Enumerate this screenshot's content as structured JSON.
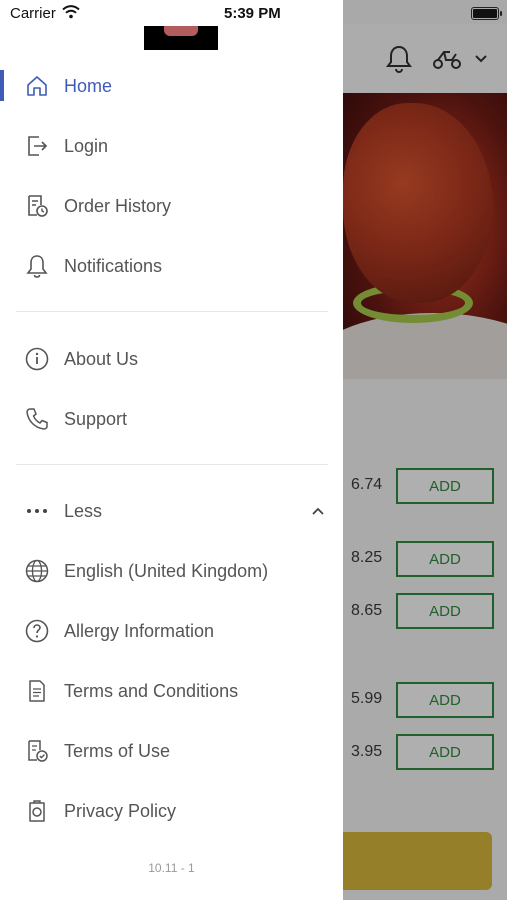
{
  "status_bar": {
    "carrier": "Carrier",
    "time": "5:39 PM"
  },
  "background": {
    "prices": [
      "6.74",
      "8.25",
      "8.65",
      "5.99",
      "3.95"
    ],
    "add_label": "ADD"
  },
  "menu": {
    "items": [
      {
        "label": "Home",
        "icon": "home-icon",
        "active": true
      },
      {
        "label": "Login",
        "icon": "login-icon"
      },
      {
        "label": "Order History",
        "icon": "order-history-icon"
      },
      {
        "label": "Notifications",
        "icon": "bell-icon"
      },
      {
        "label": "About Us",
        "icon": "info-icon"
      },
      {
        "label": "Support",
        "icon": "phone-icon"
      },
      {
        "label": "Less",
        "icon": "more-dots-icon"
      },
      {
        "label": "English (United Kingdom)",
        "icon": "globe-icon"
      },
      {
        "label": "Allergy Information",
        "icon": "help-circle-icon"
      },
      {
        "label": "Terms and Conditions",
        "icon": "document-icon"
      },
      {
        "label": "Terms of Use",
        "icon": "document-check-icon"
      },
      {
        "label": "Privacy Policy",
        "icon": "privacy-icon"
      }
    ]
  },
  "version": "10.11 - 1",
  "colors": {
    "accent": "#3e5bb8",
    "add_green": "#2e8a3e",
    "cta": "#d7b73c"
  }
}
